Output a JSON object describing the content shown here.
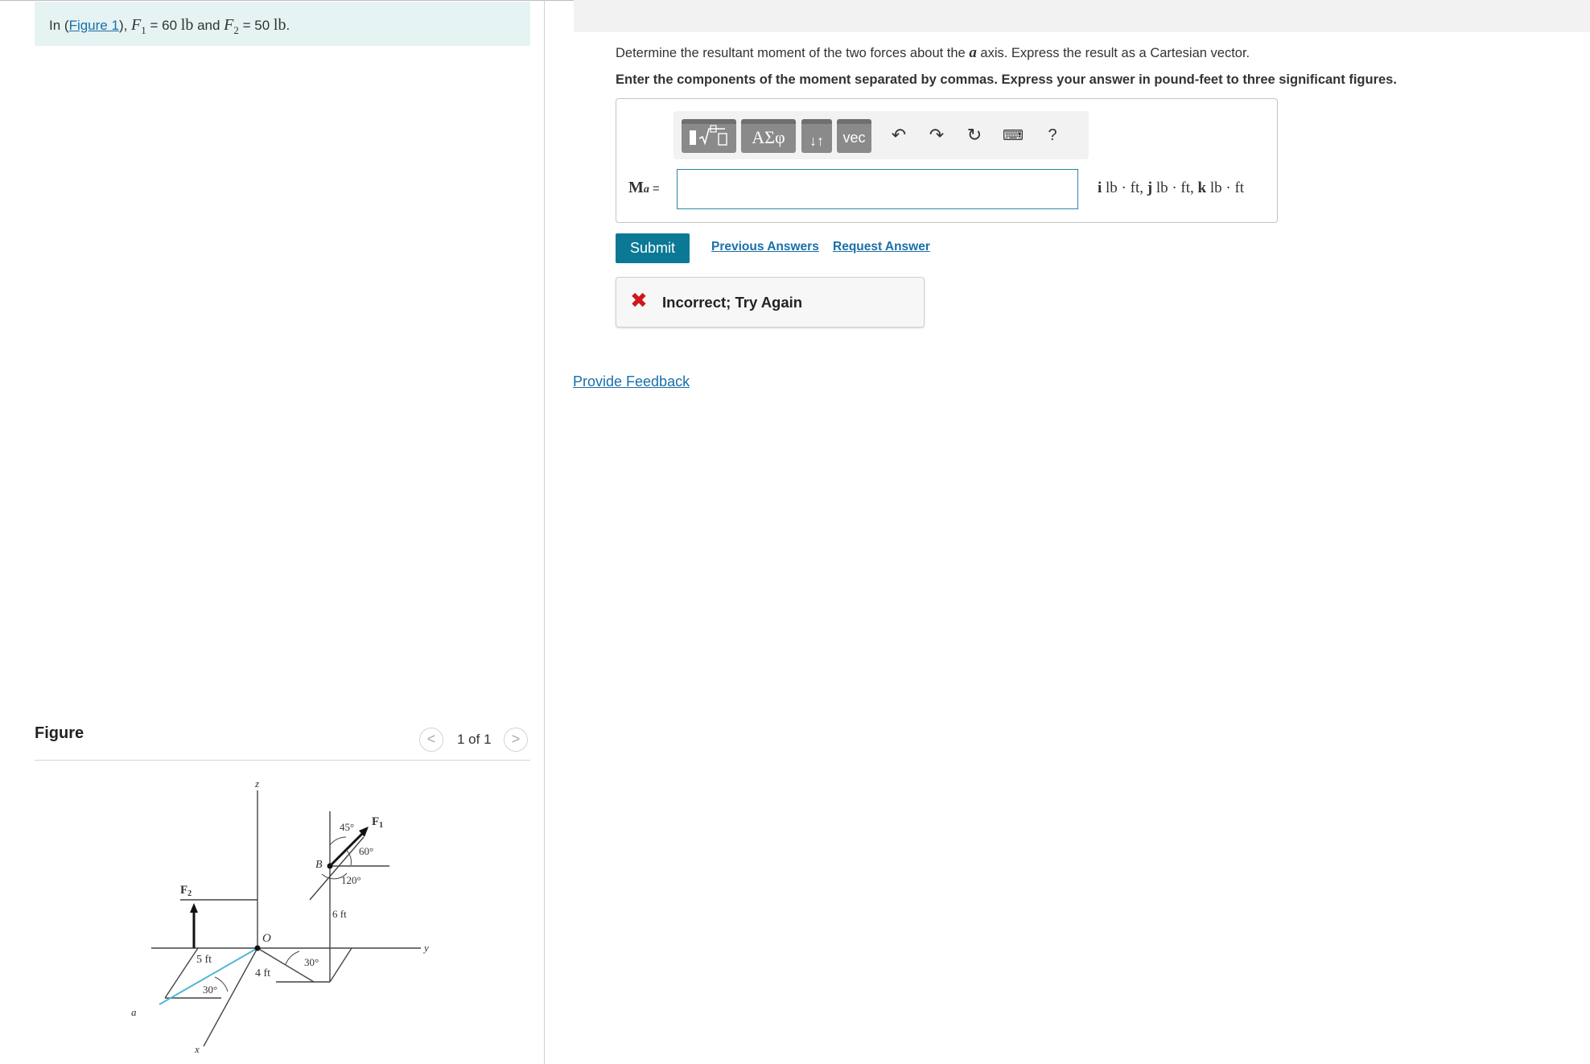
{
  "intro": {
    "prefix": "In (",
    "figure_link": "Figure 1",
    "mid": "), ",
    "f1_symbol": "F",
    "f1_sub": "1",
    "f1_eq": " = 60 ",
    "f1_unit": "lb",
    "and": " and ",
    "f2_symbol": "F",
    "f2_sub": "2",
    "f2_eq": " = 50 ",
    "f2_unit": "lb",
    "end": "."
  },
  "figure": {
    "heading": "Figure",
    "prev_icon": "chevron-left-icon",
    "next_icon": "chevron-right-icon",
    "counter": "1 of 1",
    "labels": {
      "z": "z",
      "y": "y",
      "x": "x",
      "a": "a",
      "O": "O",
      "B": "B",
      "F1": "F",
      "F1_sub": "1",
      "F2": "F",
      "F2_sub": "2",
      "ang45": "45°",
      "ang60": "60°",
      "ang120": "120°",
      "len6": "6 ft",
      "len5": "5 ft",
      "len4": "4 ft",
      "ang30a": "30°",
      "ang30b": "30°"
    },
    "colors": {
      "axis_a": "#4fb8d8",
      "lines": "#444444"
    }
  },
  "question": {
    "prefix": "Determine the resultant moment of the two forces about the ",
    "axis_symbol": "a",
    "suffix": " axis. Express the result as a Cartesian vector.",
    "instructions": "Enter the components of the moment separated by commas. Express your answer in pound-feet to three significant figures."
  },
  "toolbar": {
    "templates_icon": "fraction-sqrt-icon",
    "greek_label": "ΑΣφ",
    "arrows_label": "↓↑",
    "vec_label": "vec",
    "undo_icon": "undo-icon",
    "redo_icon": "redo-icon",
    "reset_icon": "reset-icon",
    "keyboard_icon": "keyboard-icon",
    "help_label": "?"
  },
  "answer": {
    "label_main": "M",
    "label_sub": "a",
    "label_eq": "=",
    "value": "",
    "units": {
      "i": "i",
      "u1": " lb · ft, ",
      "j": "j",
      "u2": " lb · ft, ",
      "k": "k",
      "u3": " lb · ft"
    }
  },
  "actions": {
    "submit_label": "Submit",
    "previous_answers": "Previous Answers",
    "request_answer": "Request Answer"
  },
  "feedback": {
    "icon": "x-icon",
    "status_color": "#d0161c",
    "message": "Incorrect; Try Again"
  },
  "footer": {
    "provide_feedback": "Provide Feedback"
  },
  "colors": {
    "accent": "#0b7896",
    "link": "#1a6fa8",
    "intro_bg": "#e5f3f3"
  }
}
